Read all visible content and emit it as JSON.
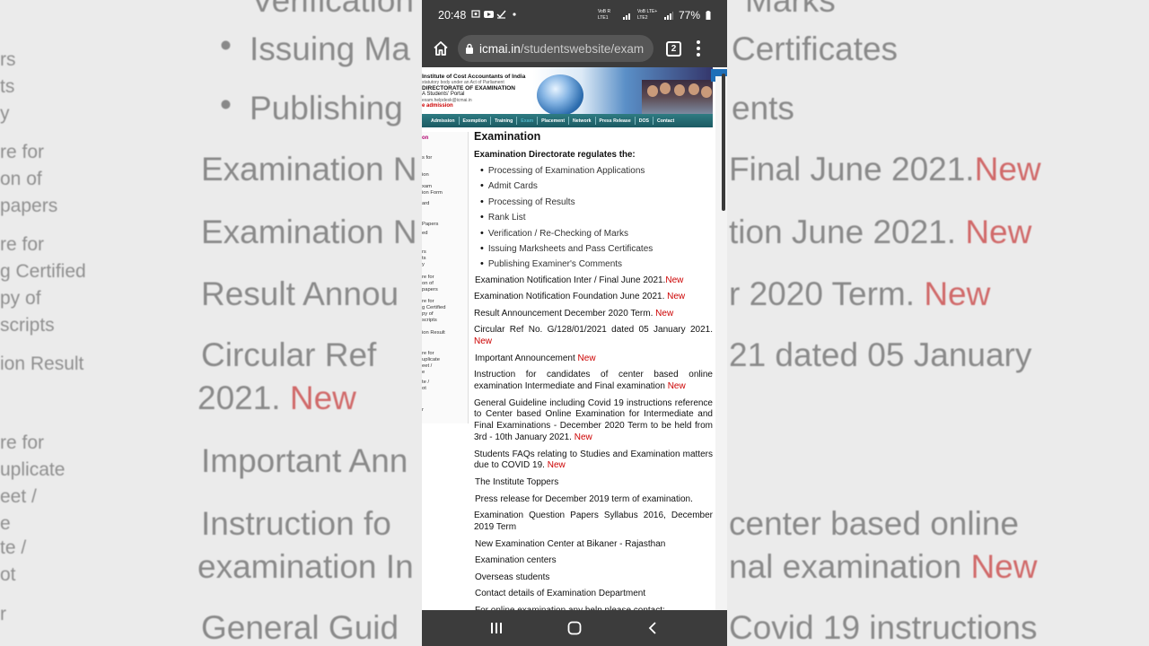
{
  "background": {
    "bullets": [
      "Issuing Ma",
      "Publishing"
    ],
    "bullets_right": [
      "Certificates",
      "ents"
    ],
    "left_fragments": [
      "rs",
      "ts",
      "y",
      "re for",
      "on of",
      "papers",
      "re for",
      "g Certified",
      "py of",
      "scripts",
      "ion Result",
      "re for",
      "uplicate",
      "eet /",
      "e",
      "te /",
      "ot",
      "r"
    ],
    "lines_left": [
      "Examination N",
      "Examination N",
      "Result Annou",
      "Circular Ref",
      "Important Ann",
      "Instruction fo",
      "examination In",
      "General Guid"
    ],
    "lines_right": [
      "Final June 2021.",
      "tion June 2021.",
      "r 2020 Term.",
      "21 dated 05 January",
      "center based online",
      "nal examination",
      "Covid 19 instructions"
    ],
    "line_2021": "2021.",
    "new_label": "New",
    "top_left": "Verification",
    "top_right": "Marks"
  },
  "status_bar": {
    "time": "20:48",
    "battery": "77%",
    "signal_left": "VoB R LTE1",
    "signal_right": "VoB LTE+ LTE2"
  },
  "browser": {
    "url_domain": "icmai.in",
    "url_path": "/studentswebsite/exam",
    "tab_count": "2"
  },
  "banner": {
    "line1": "Institute of Cost Accountants of India",
    "line2": "statutory body under an Act of Parliament",
    "line3": "DIRECTORATE OF EXAMINATION",
    "line4": "A Students' Portal",
    "line5": "exam.helpdesk@icmai.in",
    "line6": "e admission"
  },
  "nav": {
    "items": [
      "Admission",
      "Exemption",
      "Training",
      "Exam",
      "Placement",
      "Network",
      "Press Release",
      "DOS",
      "Contact"
    ]
  },
  "sidebar": {
    "items": [
      "on",
      "s for",
      "ion",
      "xam",
      "ion Form",
      "ard",
      "Papers",
      "ed",
      "rs",
      "ts",
      "y",
      "re for",
      "on of",
      "papers",
      "re for",
      "g Certified",
      "py of",
      "scripts",
      "ion Result",
      "re for",
      "uplicate",
      "eet /",
      "e",
      "te /",
      "ot",
      "r"
    ]
  },
  "content": {
    "title": "Examination",
    "subtitle": "Examination Directorate regulates the:",
    "regulates": [
      "Processing of Examination Applications",
      "Admit Cards",
      "Processing of Results",
      "Rank List",
      "Verification / Re-Checking of Marks",
      "Issuing Marksheets and Pass Certificates",
      "Publishing Examiner's Comments"
    ],
    "new_label": "New",
    "links": [
      {
        "text": "Examination Notification Inter / Final June 2021.",
        "new": true
      },
      {
        "text": "Examination Notification Foundation June 2021. ",
        "new": true
      },
      {
        "text": "Result Announcement December 2020 Term. ",
        "new": true
      },
      {
        "text": "Circular Ref No. G/128/01/2021 dated 05 January 2021. ",
        "new": true
      },
      {
        "text": "Important Announcement ",
        "new": true
      },
      {
        "text": "Instruction for candidates of center based online examination Intermediate and Final examination ",
        "new": true
      },
      {
        "text": "General Guideline including Covid 19 instructions reference to Center based Online Examination for Intermediate and Final Examinations - December 2020 Term to be held from 3rd - 10th January 2021. ",
        "new": true
      },
      {
        "text": "Students FAQs relating to Studies and Examination matters due to COVID 19. ",
        "new": true
      },
      {
        "text": "The Institute Toppers",
        "new": false
      },
      {
        "text": "Press release for December 2019 term of examination.",
        "new": false
      },
      {
        "text": "Examination Question Papers Syllabus 2016, December 2019 Term",
        "new": false
      },
      {
        "text": "New Examination Center at Bikaner - Rajasthan",
        "new": false
      },
      {
        "text": "Examination centers",
        "new": false
      },
      {
        "text": "Overseas students",
        "new": false
      },
      {
        "text": "Contact details of Examination Department",
        "new": false
      },
      {
        "text": "For online examination any help please contact:",
        "new": false
      }
    ]
  }
}
